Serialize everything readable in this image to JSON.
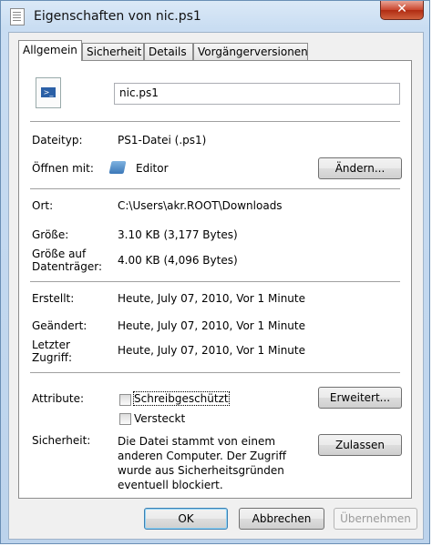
{
  "window": {
    "title": "Eigenschaften von nic.ps1",
    "close_glyph": "✕"
  },
  "tabs": [
    {
      "label": "Allgemein"
    },
    {
      "label": "Sicherheit"
    },
    {
      "label": "Details"
    },
    {
      "label": "Vorgängerversionen"
    }
  ],
  "file": {
    "icon_label": ">_",
    "name": "nic.ps1"
  },
  "fields": {
    "type_label": "Dateityp:",
    "type_value": "PS1-Datei (.ps1)",
    "opens_label": "Öffnen mit:",
    "opens_value": "Editor",
    "change_button": "Ändern...",
    "location_label": "Ort:",
    "location_value": "C:\\Users\\akr.ROOT\\Downloads",
    "size_label": "Größe:",
    "size_value": "3.10 KB (3,177 Bytes)",
    "disk_size_label_1": "Größe auf",
    "disk_size_label_2": "Datenträger:",
    "disk_size_value": "4.00 KB (4,096 Bytes)",
    "created_label": "Erstellt:",
    "created_value": "Heute, July 07, 2010, Vor 1 Minute",
    "modified_label": "Geändert:",
    "modified_value": "Heute, July 07, 2010, Vor 1 Minute",
    "accessed_label_1": "Letzter",
    "accessed_label_2": "Zugriff:",
    "accessed_value": "Heute, July 07, 2010, Vor 1 Minute",
    "attributes_label": "Attribute:",
    "readonly_label": "Schreibgeschützt",
    "hidden_label": "Versteckt",
    "advanced_button": "Erweitert...",
    "security_label": "Sicherheit:",
    "security_text": "Die Datei stammt von einem anderen Computer. Der Zugriff wurde aus Sicherheitsgründen eventuell blockiert.",
    "unblock_button": "Zulassen"
  },
  "footer": {
    "ok": "OK",
    "cancel": "Abbrechen",
    "apply": "Übernehmen"
  }
}
